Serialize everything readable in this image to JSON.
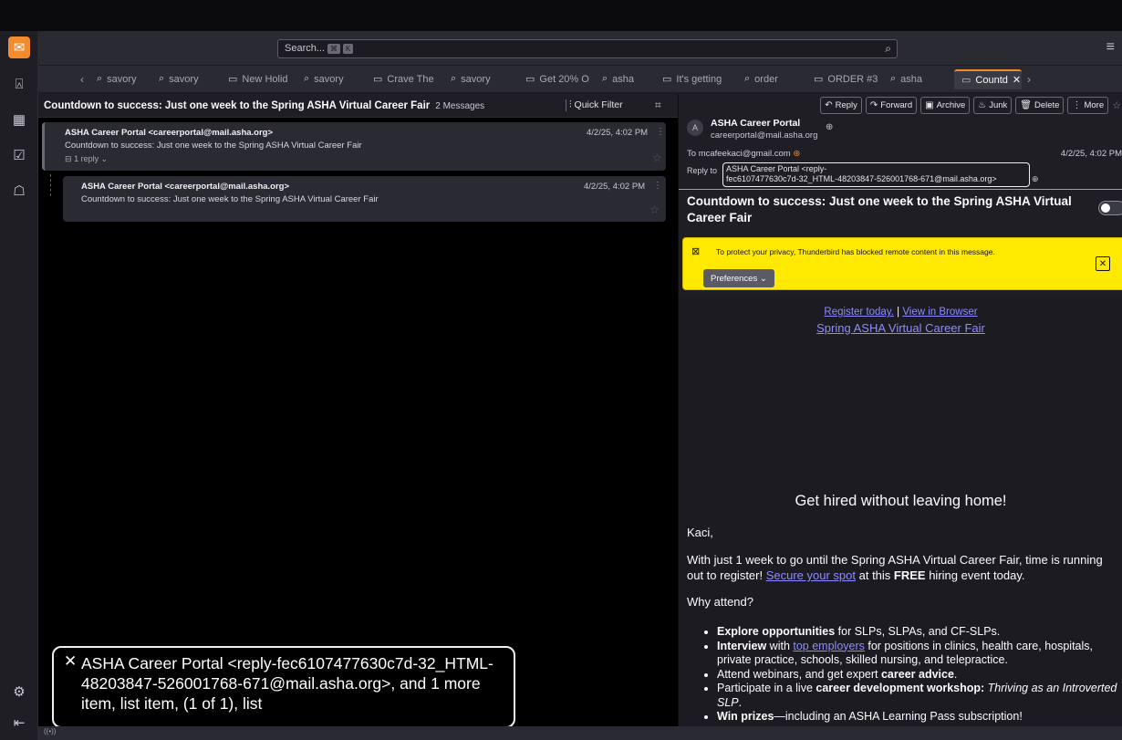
{
  "toolbar": {
    "search_placeholder": "Search...",
    "search_kbd1": "⌘",
    "search_kbd2": "K"
  },
  "tabs": [
    {
      "icon": "search-icon",
      "label": "savory"
    },
    {
      "icon": "search-icon",
      "label": "savory"
    },
    {
      "icon": "folder-icon",
      "label": "New Holid"
    },
    {
      "icon": "search-icon",
      "label": "savory"
    },
    {
      "icon": "folder-icon",
      "label": "Crave The"
    },
    {
      "icon": "search-icon",
      "label": "savory"
    },
    {
      "icon": "folder-icon",
      "label": "Get 20% O"
    },
    {
      "icon": "search-icon",
      "label": "asha"
    },
    {
      "icon": "folder-icon",
      "label": "It's getting"
    },
    {
      "icon": "search-icon",
      "label": "order"
    },
    {
      "icon": "folder-icon",
      "label": "ORDER #3"
    },
    {
      "icon": "search-icon",
      "label": "asha"
    },
    {
      "icon": "folder-icon",
      "label": "Countd",
      "active": true
    }
  ],
  "thread": {
    "title": "Countdown to success: Just one week to the Spring ASHA Virtual Career Fair",
    "count": "2 Messages",
    "quick_filter": "Quick Filter",
    "messages": [
      {
        "from": "ASHA Career Portal <careerportal@mail.asha.org>",
        "subject": "Countdown to success: Just one week to the Spring ASHA Virtual Career Fair",
        "date": "4/2/25, 4:02 PM",
        "replies": "1 reply"
      },
      {
        "from": "ASHA Career Portal <careerportal@mail.asha.org>",
        "subject": "Countdown to success: Just one week to the Spring ASHA Virtual Career Fair",
        "date": "4/2/25, 4:02 PM"
      }
    ]
  },
  "tooltip": {
    "text": "ASHA Career Portal <reply-fec6107477630c7d-32_HTML-48203847-526001768-671@mail.asha.org>, and 1 more item, list item, (1 of 1), list"
  },
  "message": {
    "actions": [
      "Reply",
      "Forward",
      "Archive",
      "Junk",
      "Delete",
      "More"
    ],
    "sender_initial": "A",
    "sender_name": "ASHA Career Portal",
    "sender_email": "careerportal@mail.asha.org",
    "to_label": "To",
    "to": "mcafeekaci@gmail.com",
    "date": "4/2/25, 4:02 PM",
    "reply_to_label": "Reply to",
    "reply_to_line1": "ASHA Career Portal <reply-",
    "reply_to_line2": "fec6107477630c7d-32_HTML-48203847-526001768-671@mail.asha.org>",
    "subject": "Countdown to success: Just one week to the Spring ASHA Virtual Career Fair",
    "notification": "To protect your privacy, Thunderbird has blocked remote content in this message.",
    "preferences": "Preferences",
    "body": {
      "register_link": "Register today.",
      "sep": " | ",
      "browser_link": "View in Browser",
      "fair_link": "Spring ASHA Virtual Career Fair",
      "headline": "Get hired without leaving home!",
      "greeting": "Kaci,",
      "p1_a": "With just 1 week to go until the Spring ASHA Virtual Career Fair, time is running out to register! ",
      "p1_link": "Secure your spot",
      "p1_b": " at this ",
      "p1_bold": "FREE",
      "p1_c": " hiring event today.",
      "why": "Why attend?",
      "b1_bold": "Explore opportunities",
      "b1": " for SLPs, SLPAs, and CF-SLPs.",
      "b2_bold": "Interview",
      "b2_a": " with ",
      "b2_link": "top employers",
      "b2_b": " for positions in clinics, health care, hospitals, private practice, schools, skilled nursing, and telepractice.",
      "b3_a": "Attend webinars, and get expert ",
      "b3_bold": "career advice",
      "b3_b": ".",
      "b4_a": "Participate in a live ",
      "b4_bold": "career development workshop:",
      "b4_italic": " Thriving as an Introverted SLP",
      "b4_b": ".",
      "b5_bold": "Win prizes",
      "b5": "—including an ASHA Learning Pass subscription!"
    }
  }
}
